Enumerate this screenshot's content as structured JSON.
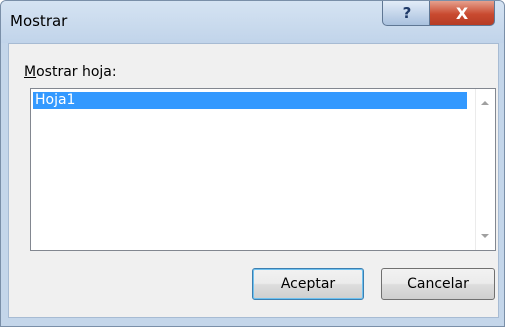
{
  "window": {
    "title": "Mostrar",
    "help_glyph": "?",
    "close_glyph": "X"
  },
  "list": {
    "label_accel": "M",
    "label_rest": "ostrar hoja:",
    "items": [
      "Hoja1"
    ],
    "selected_index": 0
  },
  "buttons": {
    "ok_label": "Aceptar",
    "cancel_label": "Cancelar"
  },
  "colors": {
    "selection": "#3399ff",
    "close_button": "#c94a30",
    "dialog_bg": "#f0f0f0"
  },
  "icons": {
    "help": "help-icon",
    "close": "close-icon",
    "scroll_up": "scroll-up-arrow-icon",
    "scroll_down": "scroll-down-arrow-icon"
  }
}
